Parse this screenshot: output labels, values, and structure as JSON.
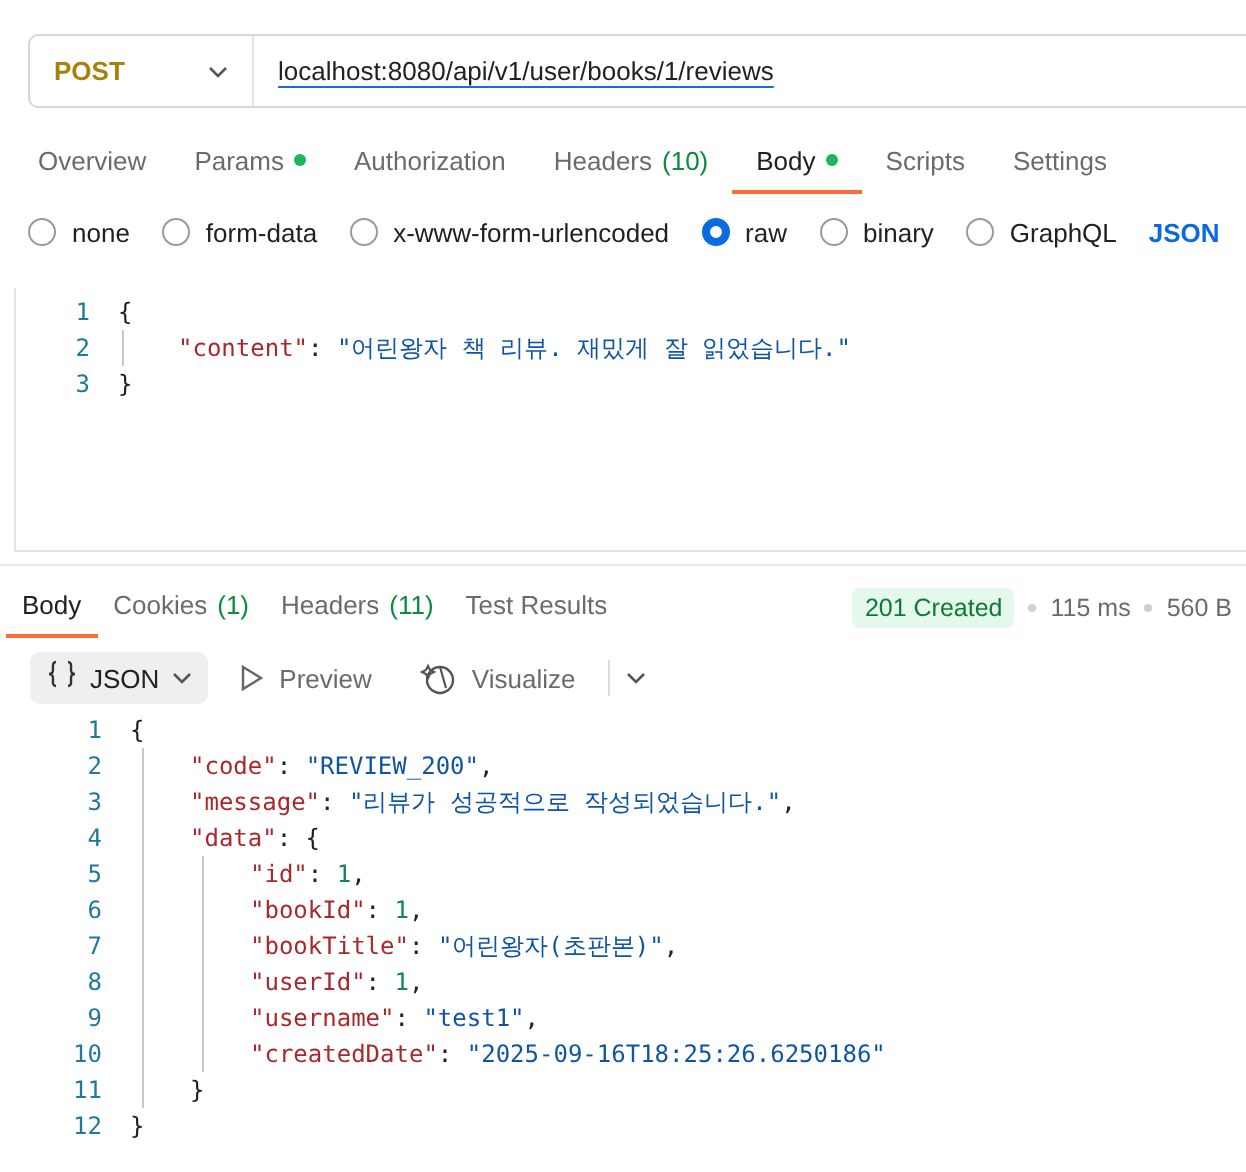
{
  "request": {
    "method": "POST",
    "url": "localhost:8080/api/v1/user/books/1/reviews"
  },
  "request_tabs": [
    {
      "label": "Overview",
      "selected": false,
      "dot": false
    },
    {
      "label": "Params",
      "selected": false,
      "dot": true
    },
    {
      "label": "Authorization",
      "selected": false,
      "dot": false
    },
    {
      "label": "Headers",
      "count": "(10)",
      "selected": false,
      "dot": false
    },
    {
      "label": "Body",
      "selected": true,
      "dot": true
    },
    {
      "label": "Scripts",
      "selected": false,
      "dot": false
    },
    {
      "label": "Settings",
      "selected": false,
      "dot": false
    }
  ],
  "body_types": [
    {
      "label": "none",
      "selected": false
    },
    {
      "label": "form-data",
      "selected": false
    },
    {
      "label": "x-www-form-urlencoded",
      "selected": false
    },
    {
      "label": "raw",
      "selected": true
    },
    {
      "label": "binary",
      "selected": false
    },
    {
      "label": "GraphQL",
      "selected": false
    }
  ],
  "body_format": "JSON",
  "request_body": [
    {
      "number": "1",
      "tokens": [
        {
          "kind": "punct",
          "text": "{"
        }
      ],
      "children": [
        {
          "number": "2",
          "tokens": [
            {
              "kind": "key",
              "text": "\"content\""
            },
            {
              "kind": "punct",
              "text": ": "
            },
            {
              "kind": "string",
              "text": "\"어린왕자 책 리뷰. 재밌게 잘 읽었습니다.\""
            }
          ]
        }
      ]
    },
    {
      "number": "3",
      "tokens": [
        {
          "kind": "punct",
          "text": "}"
        }
      ]
    }
  ],
  "response_tabs": [
    {
      "label": "Body",
      "selected": true
    },
    {
      "label": "Cookies",
      "count": "(1)",
      "selected": false
    },
    {
      "label": "Headers",
      "count": "(11)",
      "selected": false
    },
    {
      "label": "Test Results",
      "selected": false
    }
  ],
  "response_status": {
    "status": "201 Created",
    "time": "115 ms",
    "size": "560 B"
  },
  "response_toolbar": {
    "format": "JSON",
    "preview": "Preview",
    "visualize": "Visualize"
  },
  "response_body": [
    {
      "number": "1",
      "tokens": [
        {
          "kind": "punct",
          "text": "{"
        }
      ],
      "children": [
        {
          "number": "2",
          "tokens": [
            {
              "kind": "key",
              "text": "\"code\""
            },
            {
              "kind": "punct",
              "text": ": "
            },
            {
              "kind": "string",
              "text": "\"REVIEW_200\""
            },
            {
              "kind": "punct",
              "text": ","
            }
          ]
        },
        {
          "number": "3",
          "tokens": [
            {
              "kind": "key",
              "text": "\"message\""
            },
            {
              "kind": "punct",
              "text": ": "
            },
            {
              "kind": "string",
              "text": "\"리뷰가 성공적으로 작성되었습니다.\""
            },
            {
              "kind": "punct",
              "text": ","
            }
          ]
        },
        {
          "number": "4",
          "tokens": [
            {
              "kind": "key",
              "text": "\"data\""
            },
            {
              "kind": "punct",
              "text": ": {"
            }
          ],
          "children": [
            {
              "number": "5",
              "tokens": [
                {
                  "kind": "key",
                  "text": "\"id\""
                },
                {
                  "kind": "punct",
                  "text": ": "
                },
                {
                  "kind": "number",
                  "text": "1"
                },
                {
                  "kind": "punct",
                  "text": ","
                }
              ]
            },
            {
              "number": "6",
              "tokens": [
                {
                  "kind": "key",
                  "text": "\"bookId\""
                },
                {
                  "kind": "punct",
                  "text": ": "
                },
                {
                  "kind": "number",
                  "text": "1"
                },
                {
                  "kind": "punct",
                  "text": ","
                }
              ]
            },
            {
              "number": "7",
              "tokens": [
                {
                  "kind": "key",
                  "text": "\"bookTitle\""
                },
                {
                  "kind": "punct",
                  "text": ": "
                },
                {
                  "kind": "string",
                  "text": "\"어린왕자(초판본)\""
                },
                {
                  "kind": "punct",
                  "text": ","
                }
              ]
            },
            {
              "number": "8",
              "tokens": [
                {
                  "kind": "key",
                  "text": "\"userId\""
                },
                {
                  "kind": "punct",
                  "text": ": "
                },
                {
                  "kind": "number",
                  "text": "1"
                },
                {
                  "kind": "punct",
                  "text": ","
                }
              ]
            },
            {
              "number": "9",
              "tokens": [
                {
                  "kind": "key",
                  "text": "\"username\""
                },
                {
                  "kind": "punct",
                  "text": ": "
                },
                {
                  "kind": "string",
                  "text": "\"test1\""
                },
                {
                  "kind": "punct",
                  "text": ","
                }
              ]
            },
            {
              "number": "10",
              "tokens": [
                {
                  "kind": "key",
                  "text": "\"createdDate\""
                },
                {
                  "kind": "punct",
                  "text": ": "
                },
                {
                  "kind": "string",
                  "text": "\"2025-09-16T18:25:26.6250186\""
                }
              ]
            }
          ]
        },
        {
          "number": "11",
          "tokens": [
            {
              "kind": "punct",
              "text": "}"
            }
          ]
        }
      ]
    },
    {
      "number": "12",
      "tokens": [
        {
          "kind": "punct",
          "text": "}"
        }
      ]
    }
  ]
}
